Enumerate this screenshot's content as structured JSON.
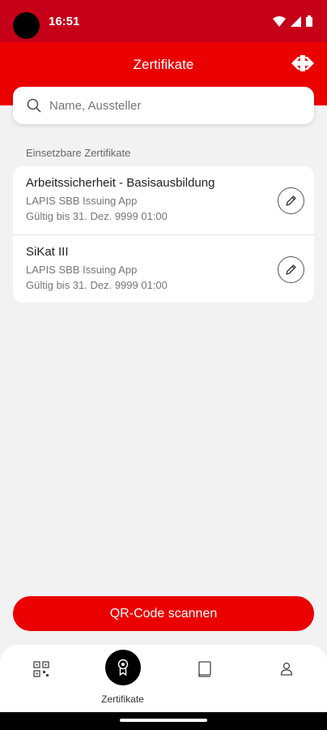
{
  "status": {
    "time": "16:51"
  },
  "header": {
    "title": "Zertifikate"
  },
  "search": {
    "placeholder": "Name, Aussteller"
  },
  "section": {
    "label": "Einsetzbare Zertifikate"
  },
  "certificates": [
    {
      "title": "Arbeitssicherheit - Basisausbildung",
      "issuer": "LAPIS SBB Issuing App",
      "validity": "Gültig bis 31. Dez. 9999 01:00"
    },
    {
      "title": "SiKat III",
      "issuer": "LAPIS SBB Issuing App",
      "validity": "Gültig bis 31. Dez. 9999 01:00"
    }
  ],
  "actions": {
    "scan_label": "QR-Code scannen"
  },
  "nav": {
    "items": [
      {
        "icon": "qr-code-icon",
        "label": ""
      },
      {
        "icon": "certificate-icon",
        "label": "Zertifikate",
        "active": true
      },
      {
        "icon": "book-icon",
        "label": ""
      },
      {
        "icon": "user-icon",
        "label": ""
      }
    ]
  },
  "colors": {
    "brand_red": "#eb0000",
    "status_red": "#c60018"
  }
}
